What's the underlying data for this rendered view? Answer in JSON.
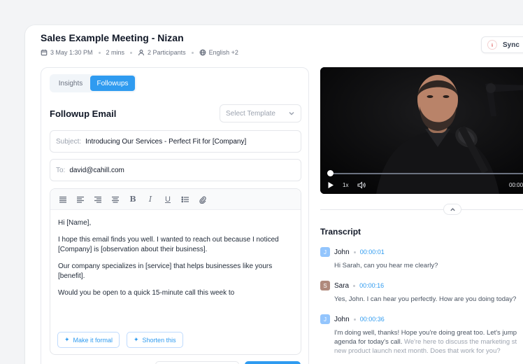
{
  "meeting": {
    "title": "Sales Example Meeting - Nizan",
    "date": "3 May 1:30 PM",
    "duration": "2 mins",
    "participants": "2 Participants",
    "language": "English +2"
  },
  "header": {
    "sync_label": "Sync"
  },
  "tabs": [
    {
      "label": "Insights",
      "active": false
    },
    {
      "label": "Followups",
      "active": true
    }
  ],
  "followup": {
    "title": "Followup Email",
    "template_placeholder": "Select Template",
    "subject_label": "Subject:",
    "subject_value": "Introducing Our Services - Perfect Fit for [Company]",
    "to_label": "To:",
    "to_value": "david@cahill.com",
    "toolbar_icons": [
      "align-justify-icon",
      "align-left-icon",
      "align-right-icon",
      "align-center-icon",
      "bold-icon",
      "italic-icon",
      "underline-icon",
      "bullet-list-icon",
      "attachment-icon"
    ],
    "body": [
      "Hi [Name],",
      "I hope this email finds you well. I wanted to reach out because I noticed [Company] is [observation about their business].",
      "Our company specializes in [service] that helps businesses like yours [benefit].",
      "Would you be open to a quick 15-minute call this week to"
    ],
    "ai_actions": [
      "Make it formal",
      "Shorten this"
    ]
  },
  "video": {
    "speed": "1x",
    "time": "00:00",
    "progress": 0.01
  },
  "transcript": {
    "title": "Transcript",
    "entries": [
      {
        "initial": "J",
        "speaker": "John",
        "time": "00:00:01",
        "text": "Hi Sarah, can you hear me clearly?",
        "muted_text": ""
      },
      {
        "initial": "S",
        "speaker": "Sara",
        "time": "00:00:16",
        "text": "Yes, John. I can hear you perfectly. How are you doing today?",
        "muted_text": ""
      },
      {
        "initial": "J",
        "speaker": "John",
        "time": "00:00:36",
        "text": "I'm doing well, thanks! Hope you're doing great too. Let's jump",
        "text2": "agenda for today's call.",
        "muted_text": "We're here to discuss the marketing st",
        "muted_text2": "new product launch next month. Does that work for you?"
      }
    ]
  },
  "colors": {
    "accent": "#2f9bf0",
    "avatar_john": "#93c5fd",
    "avatar_sara": "#b08a7c"
  }
}
